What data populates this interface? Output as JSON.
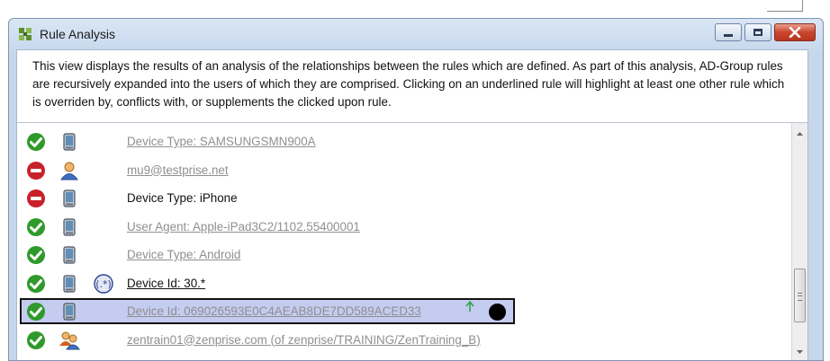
{
  "window": {
    "title": "Rule Analysis",
    "description": "This view displays the results of an analysis of the relationships between the rules which are defined. As part of this analysis, AD-Group rules are recursively expanded into the users of which they are comprised. Clicking on an underlined rule will highlight at least one other rule which is overriden by, conflicts with, or supplements the clicked upon rule."
  },
  "rules": [
    {
      "status": "allowed-check-icon",
      "type": "mobile-device-icon",
      "label": "Device Type: SAMSUNGSMN900A",
      "style": "link"
    },
    {
      "status": "blocked-icon",
      "type": "user-icon",
      "label": "mu9@testprise.net",
      "style": "link"
    },
    {
      "status": "blocked-icon",
      "type": "mobile-device-icon",
      "label": "Device Type: iPhone",
      "style": "plain"
    },
    {
      "status": "allowed-check-icon",
      "type": "mobile-device-icon",
      "label": "User Agent: Apple-iPad3C2/1102.55400001",
      "style": "link"
    },
    {
      "status": "allowed-check-icon",
      "type": "mobile-device-icon",
      "label": "Device Type: Android",
      "style": "link"
    },
    {
      "status": "allowed-check-icon",
      "type": "mobile-device-icon",
      "extra": "regex-icon",
      "label": "Device Id: 30.*",
      "style": "link-dark"
    },
    {
      "status": "allowed-check-icon",
      "type": "mobile-device-icon",
      "label": "Device Id: 069026593E0C4AEAB8DE7DD589ACED33",
      "style": "link",
      "selected": true
    },
    {
      "status": "allowed-check-icon",
      "type": "group-icon",
      "label": "zentrain01@zenprise.com (of zenprise/TRAINING/ZenTraining_B)",
      "style": "link"
    }
  ],
  "colors": {
    "allowed": "#2f9a2a",
    "blocked": "#c8202a",
    "selection": "#c4ccf0",
    "link_text": "#8f8f8f"
  }
}
